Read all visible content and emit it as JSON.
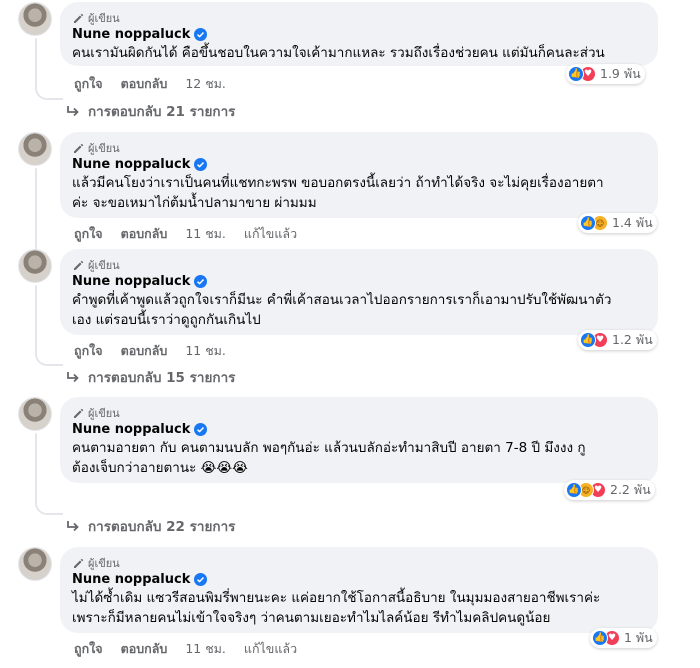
{
  "author_badge": "ผู้เขียน",
  "actions": {
    "like": "ถูกใจ",
    "reply": "ตอบกลับ",
    "edited": "แก้ไขแล้ว"
  },
  "comments": [
    {
      "name": "Nune noppaluck",
      "lines": [
        "คนเรามันผิดกันได้ คือขึ้นชอบในความใจเค้ามากแหละ รวมถึงเรื่องช่วยคน แต่มันก็คนละส่วน"
      ],
      "time": "12 ชม.",
      "edited": false,
      "reactions": [
        "like",
        "love"
      ],
      "reaction_count": "1.9 พัน",
      "replies": "การตอบกลับ 21 รายการ"
    },
    {
      "name": "Nune noppaluck",
      "lines": [
        "แล้วมีคนโยงว่าเราเป็นคนที่แชทกะพรพ ขอบอกตรงนี้เลยว่า ถ้าทำได้จริง จะไม่คุยเรื่องอายตา",
        "ค่ะ จะขอเหมาไก่ต้มน้ำปลามาขาย ผ่ามมม"
      ],
      "time": "11 ชม.",
      "edited": true,
      "reactions": [
        "like",
        "haha"
      ],
      "reaction_count": "1.4 พัน",
      "replies": ""
    },
    {
      "name": "Nune noppaluck",
      "lines": [
        "คำพูดที่เค้าพูดแล้วถูกใจเราก็มีนะ คำพี่เค้าสอนเวลาไปออกรายการเราก็เอามาปรับใช้พัฒนาตัว",
        "เอง แต่รอบนี้เราว่าดูถูกกันเกินไป"
      ],
      "time": "11 ชม.",
      "edited": false,
      "reactions": [
        "like",
        "love"
      ],
      "reaction_count": "1.2 พัน",
      "replies": "การตอบกลับ 15 รายการ"
    },
    {
      "name": "Nune noppaluck",
      "lines": [
        "คนตามอายตา กับ คนตามนบลัก พอๆกันอ่ะ แล้วนบลักอ่ะทำมาสิบปี อายตา 7-8 ปี มึงงง กู",
        "ต้องเจ็บกว่าอายตานะ 😭😭😭"
      ],
      "time": "",
      "edited": false,
      "reactions": [
        "like",
        "haha",
        "love"
      ],
      "reaction_count": "2.2 พัน",
      "replies": "การตอบกลับ 22 รายการ"
    },
    {
      "name": "Nune noppaluck",
      "lines": [
        "ไม่ได้ซ้ำเดิม แซวรีสอนพิมรี่พายนะคะ แค่อยากใช้โอกาสนี้อธิบาย ในมุมมองสายอาชีพเราค่ะ",
        "เพราะก็มีหลายคนไม่เข้าใจจริงๆ ว่าคนตามเยอะทำไมไลค์น้อย รีทำไมคลิปคนดูน้อย"
      ],
      "time": "11 ชม.",
      "edited": true,
      "reactions": [
        "like",
        "love"
      ],
      "reaction_count": "1 พัน",
      "replies": ""
    }
  ]
}
